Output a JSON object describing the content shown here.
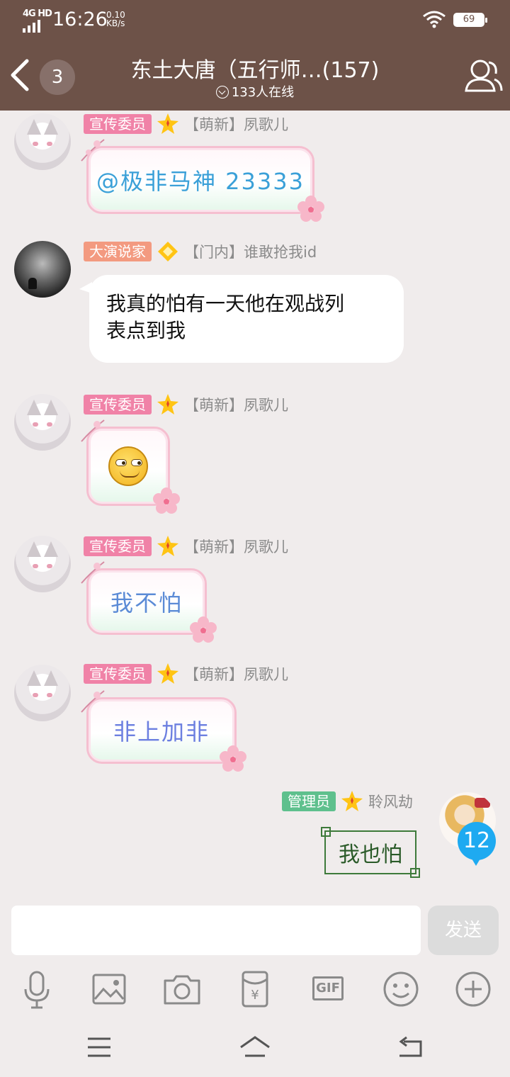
{
  "status_bar": {
    "network": "4G HD",
    "time": "16:26",
    "speed_value": "0.10",
    "speed_unit": "KB/s",
    "battery": "69"
  },
  "header": {
    "unread_count": "3",
    "title": "东土大唐（五行师…(157)",
    "online": "133人在线",
    "icons": [
      "back-arrow-icon",
      "members-icon",
      "online-dropdown-icon"
    ]
  },
  "messages": [
    {
      "role": "宣传委员",
      "sender": "【萌新】夙歌儿",
      "content_type": "sticker",
      "text": "@极非马神 23333",
      "text_color": "#3aa0d8"
    },
    {
      "role": "大演说家",
      "sender": "【门内】谁敢抢我id",
      "content_type": "text",
      "lines": [
        "我真的怕有一天他在观战列",
        "表点到我"
      ]
    },
    {
      "role": "宣传委员",
      "sender": "【萌新】夙歌儿",
      "content_type": "emoji",
      "emoji": "smirk-emoji"
    },
    {
      "role": "宣传委员",
      "sender": "【萌新】夙歌儿",
      "content_type": "sticker",
      "text": "我不怕",
      "text_color": "#5b8bd6"
    },
    {
      "role": "宣传委员",
      "sender": "【萌新】夙歌儿",
      "content_type": "sticker",
      "text": "非上加非",
      "text_color": "#6c7fe0"
    },
    {
      "role": "管理员",
      "sender": "聆风劫",
      "content_type": "framed",
      "text": "我也怕",
      "avatar_badge": "12"
    }
  ],
  "composer": {
    "placeholder": "",
    "send_label": "发送",
    "tools": [
      "microphone-icon",
      "image-icon",
      "camera-icon",
      "red-packet-icon",
      "gif-icon",
      "emoji-icon",
      "plus-icon"
    ],
    "gif_label": "GIF",
    "redpacket_symbol": "¥"
  },
  "colors": {
    "header_bg": "#6d5248",
    "chat_bg": "#f0ecec",
    "tag_pink": "#f082a7",
    "tag_orange": "#f39a80",
    "tag_green": "#5ec08d",
    "badge_blue": "#1eaaf1"
  }
}
